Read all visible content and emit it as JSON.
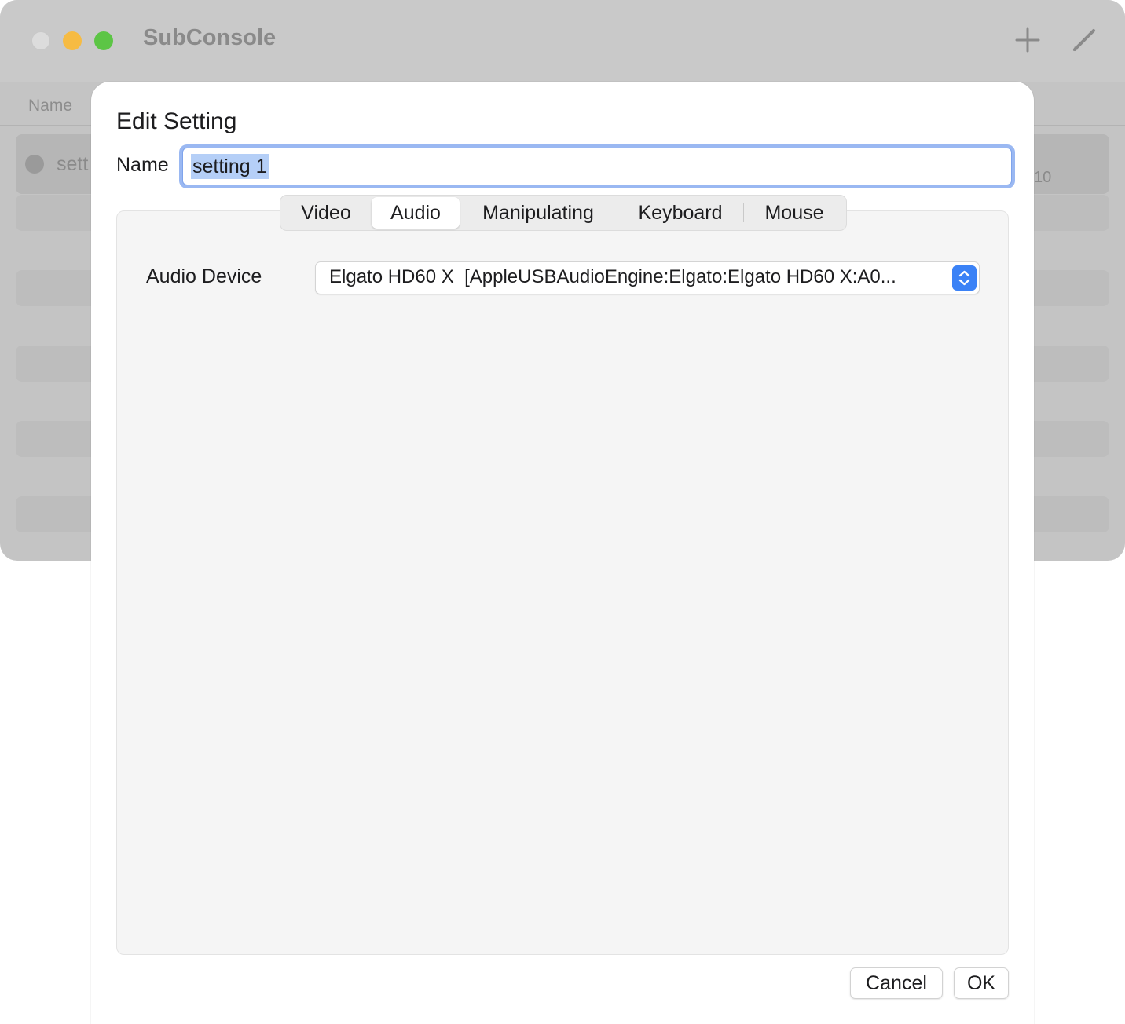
{
  "window": {
    "title": "SubConsole",
    "toolbar": {
      "add_icon": "plus-icon",
      "edit_icon": "pencil-icon"
    },
    "list": {
      "header_name": "Name",
      "selected_row_name": "sett",
      "selected_row_right": "10"
    }
  },
  "sheet": {
    "title": "Edit Setting",
    "name_label": "Name",
    "name_value": "setting 1",
    "tabs": [
      "Video",
      "Audio",
      "Manipulating",
      "Keyboard",
      "Mouse"
    ],
    "active_tab": "Audio",
    "audio": {
      "device_label": "Audio Device",
      "device_value": "Elgato HD60 X  [AppleUSBAudioEngine:Elgato:Elgato HD60 X:A0..."
    },
    "buttons": {
      "cancel": "Cancel",
      "ok": "OK"
    }
  },
  "colors": {
    "accent": "#3b82f6",
    "focus_ring": "#9ab8f2",
    "selection": "#b5cff7",
    "traffic_close": "#dcdcdc",
    "traffic_min": "#f6bb43",
    "traffic_max": "#5cc545"
  }
}
